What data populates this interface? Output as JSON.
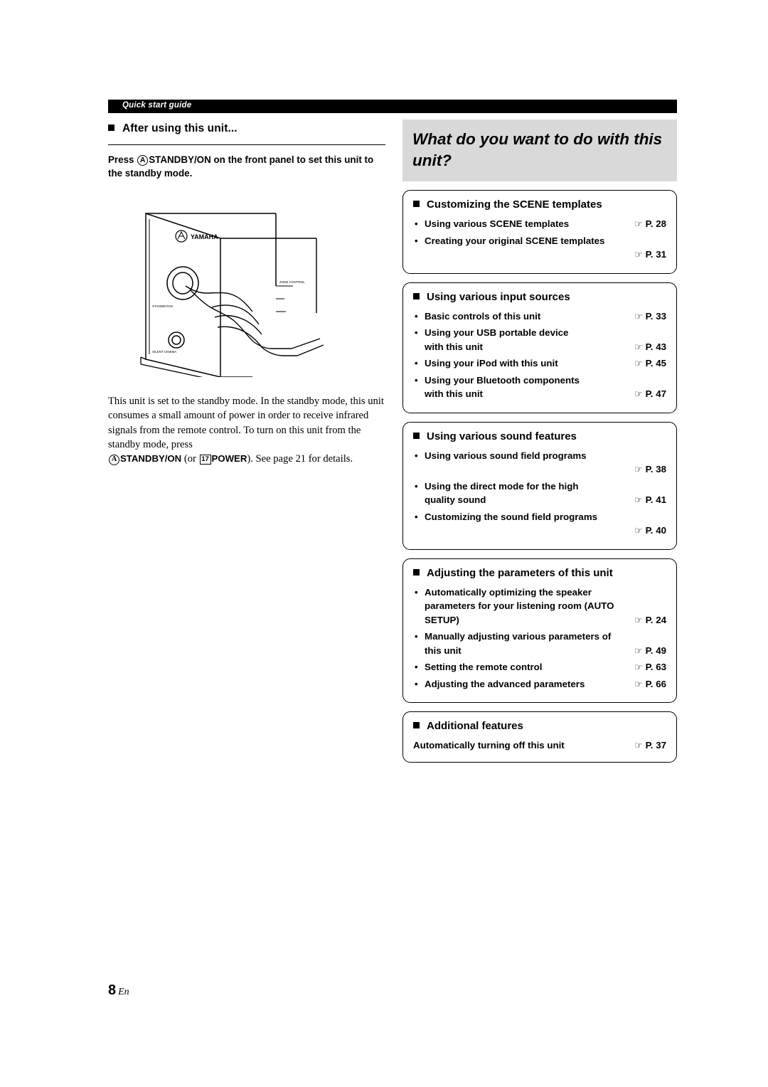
{
  "header": {
    "running_title": "Quick start guide"
  },
  "left": {
    "section_title": "After using this unit...",
    "press_instruction_pre": "Press ",
    "press_circle_a": "A",
    "press_instruction_bold": "STANDBY/ON",
    "press_instruction_post": " on the front panel to set this unit to the standby mode.",
    "illustration": {
      "brand": "YAMAHA",
      "label_standby": "STANDBY/ON",
      "label_silent": "SILENT CINEMA",
      "label_zone": "ZONE CONTROL"
    },
    "paragraph_1": "This unit is set to the standby mode. In the standby mode, this unit consumes a small amount of power in order to receive infrared signals from the remote control. To turn on this unit from the standby mode, press",
    "paragraph_2_a": "A",
    "paragraph_2_standby": "STANDBY/ON",
    "paragraph_2_or": " (or ",
    "paragraph_2_num": "17",
    "paragraph_2_power": "POWER",
    "paragraph_2_tail": "). See page 21 for details."
  },
  "right": {
    "title": "What do you want to do with this unit?",
    "cards": [
      {
        "heading": "Customizing the SCENE templates",
        "items": [
          {
            "bullet": true,
            "lines": [
              "Using various SCENE templates"
            ],
            "page": "P. 28",
            "page_on_line": 0
          },
          {
            "bullet": true,
            "lines": [
              "Creating your original SCENE templates",
              ""
            ],
            "page": "P. 31",
            "page_on_line": 1
          }
        ]
      },
      {
        "heading": "Using various input sources",
        "items": [
          {
            "bullet": true,
            "lines": [
              "Basic controls of this unit"
            ],
            "page": "P. 33",
            "page_on_line": 0
          },
          {
            "bullet": true,
            "lines": [
              "Using your USB portable device",
              "with this unit"
            ],
            "page": "P. 43",
            "page_on_line": 1
          },
          {
            "bullet": true,
            "lines": [
              "Using your iPod with this unit"
            ],
            "page": "P. 45",
            "page_on_line": 0
          },
          {
            "bullet": true,
            "lines": [
              "Using your Bluetooth components",
              "with this unit"
            ],
            "page": "P. 47",
            "page_on_line": 1
          }
        ]
      },
      {
        "heading": "Using various sound features",
        "items": [
          {
            "bullet": true,
            "lines": [
              "Using various sound field programs",
              ""
            ],
            "page": "P. 38",
            "page_on_line": 1
          },
          {
            "bullet": true,
            "lines": [
              "Using the direct mode for the high",
              "quality sound"
            ],
            "page": "P. 41",
            "page_on_line": 1
          },
          {
            "bullet": true,
            "lines": [
              "Customizing the sound field programs",
              ""
            ],
            "page": "P. 40",
            "page_on_line": 1
          }
        ]
      },
      {
        "heading": "Adjusting the parameters of this unit",
        "items": [
          {
            "bullet": true,
            "lines": [
              "Automatically optimizing the speaker",
              "parameters for your listening room (AUTO",
              "SETUP)"
            ],
            "page": "P. 24",
            "page_on_line": 2
          },
          {
            "bullet": true,
            "lines": [
              "Manually adjusting various parameters of",
              "this unit"
            ],
            "page": "P. 49",
            "page_on_line": 1
          },
          {
            "bullet": true,
            "lines": [
              "Setting the remote control"
            ],
            "page": "P. 63",
            "page_on_line": 0
          },
          {
            "bullet": true,
            "lines": [
              "Adjusting the advanced parameters"
            ],
            "page": "P. 66",
            "page_on_line": 0
          }
        ]
      },
      {
        "heading": "Additional features",
        "items": [
          {
            "bullet": false,
            "lines": [
              "Automatically turning off this unit"
            ],
            "page": "P. 37",
            "page_on_line": 0
          }
        ]
      }
    ]
  },
  "footer": {
    "page_number": "8",
    "language": "En"
  }
}
